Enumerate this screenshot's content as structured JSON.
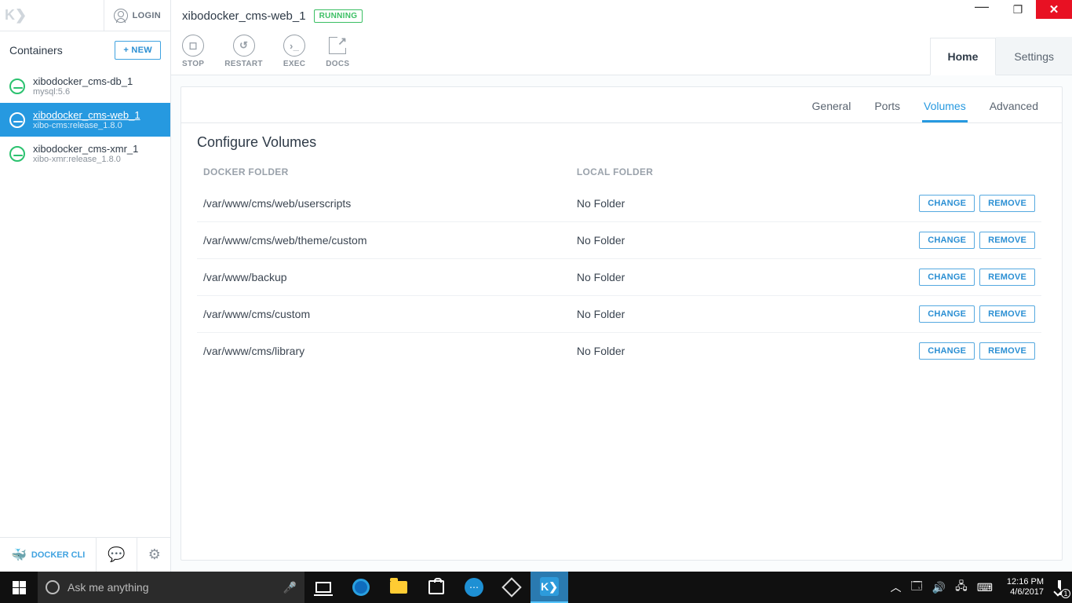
{
  "window": {
    "min": "—",
    "max": "❐",
    "close": "✕"
  },
  "sidebar": {
    "login": "LOGIN",
    "section_title": "Containers",
    "new_btn": "+  NEW",
    "items": [
      {
        "name": "xibodocker_cms-db_1",
        "sub": "mysql:5.6"
      },
      {
        "name": "xibodocker_cms-web_1",
        "sub": "xibo-cms:release_1.8.0"
      },
      {
        "name": "xibodocker_cms-xmr_1",
        "sub": "xibo-xmr:release_1.8.0"
      }
    ],
    "footer": {
      "cli": "DOCKER CLI"
    }
  },
  "header": {
    "title": "xibodocker_cms-web_1",
    "status": "RUNNING",
    "actions": {
      "stop": "STOP",
      "restart": "RESTART",
      "exec": "EXEC",
      "docs": "DOCS"
    },
    "top_tabs": {
      "home": "Home",
      "settings": "Settings"
    }
  },
  "tabs": {
    "general": "General",
    "ports": "Ports",
    "volumes": "Volumes",
    "advanced": "Advanced"
  },
  "volumes": {
    "title": "Configure Volumes",
    "col_docker": "DOCKER FOLDER",
    "col_local": "LOCAL FOLDER",
    "change": "CHANGE",
    "remove": "REMOVE",
    "rows": [
      {
        "docker": "/var/www/cms/web/userscripts",
        "local": "No Folder"
      },
      {
        "docker": "/var/www/cms/web/theme/custom",
        "local": "No Folder"
      },
      {
        "docker": "/var/www/backup",
        "local": "No Folder"
      },
      {
        "docker": "/var/www/cms/custom",
        "local": "No Folder"
      },
      {
        "docker": "/var/www/cms/library",
        "local": "No Folder"
      }
    ]
  },
  "taskbar": {
    "search_placeholder": "Ask me anything",
    "time": "12:16 PM",
    "date": "4/6/2017",
    "notif_count": "1"
  }
}
